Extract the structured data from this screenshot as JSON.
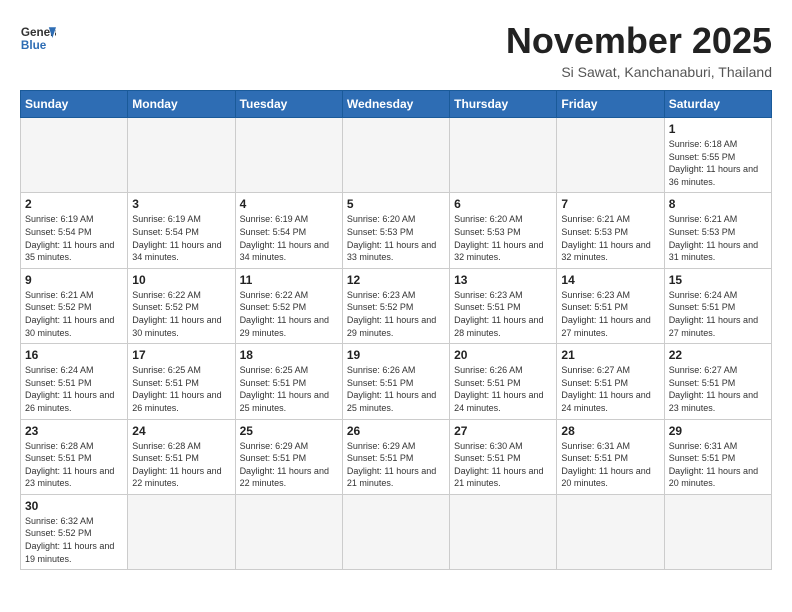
{
  "header": {
    "logo_line1": "General",
    "logo_line2": "Blue",
    "month_title": "November 2025",
    "location": "Si Sawat, Kanchanaburi, Thailand"
  },
  "weekdays": [
    "Sunday",
    "Monday",
    "Tuesday",
    "Wednesday",
    "Thursday",
    "Friday",
    "Saturday"
  ],
  "weeks": [
    [
      {
        "day": "",
        "sunrise": "",
        "sunset": "",
        "daylight": ""
      },
      {
        "day": "",
        "sunrise": "",
        "sunset": "",
        "daylight": ""
      },
      {
        "day": "",
        "sunrise": "",
        "sunset": "",
        "daylight": ""
      },
      {
        "day": "",
        "sunrise": "",
        "sunset": "",
        "daylight": ""
      },
      {
        "day": "",
        "sunrise": "",
        "sunset": "",
        "daylight": ""
      },
      {
        "day": "",
        "sunrise": "",
        "sunset": "",
        "daylight": ""
      },
      {
        "day": "1",
        "sunrise": "Sunrise: 6:18 AM",
        "sunset": "Sunset: 5:55 PM",
        "daylight": "Daylight: 11 hours and 36 minutes."
      }
    ],
    [
      {
        "day": "2",
        "sunrise": "Sunrise: 6:19 AM",
        "sunset": "Sunset: 5:54 PM",
        "daylight": "Daylight: 11 hours and 35 minutes."
      },
      {
        "day": "3",
        "sunrise": "Sunrise: 6:19 AM",
        "sunset": "Sunset: 5:54 PM",
        "daylight": "Daylight: 11 hours and 34 minutes."
      },
      {
        "day": "4",
        "sunrise": "Sunrise: 6:19 AM",
        "sunset": "Sunset: 5:54 PM",
        "daylight": "Daylight: 11 hours and 34 minutes."
      },
      {
        "day": "5",
        "sunrise": "Sunrise: 6:20 AM",
        "sunset": "Sunset: 5:53 PM",
        "daylight": "Daylight: 11 hours and 33 minutes."
      },
      {
        "day": "6",
        "sunrise": "Sunrise: 6:20 AM",
        "sunset": "Sunset: 5:53 PM",
        "daylight": "Daylight: 11 hours and 32 minutes."
      },
      {
        "day": "7",
        "sunrise": "Sunrise: 6:21 AM",
        "sunset": "Sunset: 5:53 PM",
        "daylight": "Daylight: 11 hours and 32 minutes."
      },
      {
        "day": "8",
        "sunrise": "Sunrise: 6:21 AM",
        "sunset": "Sunset: 5:53 PM",
        "daylight": "Daylight: 11 hours and 31 minutes."
      }
    ],
    [
      {
        "day": "9",
        "sunrise": "Sunrise: 6:21 AM",
        "sunset": "Sunset: 5:52 PM",
        "daylight": "Daylight: 11 hours and 30 minutes."
      },
      {
        "day": "10",
        "sunrise": "Sunrise: 6:22 AM",
        "sunset": "Sunset: 5:52 PM",
        "daylight": "Daylight: 11 hours and 30 minutes."
      },
      {
        "day": "11",
        "sunrise": "Sunrise: 6:22 AM",
        "sunset": "Sunset: 5:52 PM",
        "daylight": "Daylight: 11 hours and 29 minutes."
      },
      {
        "day": "12",
        "sunrise": "Sunrise: 6:23 AM",
        "sunset": "Sunset: 5:52 PM",
        "daylight": "Daylight: 11 hours and 29 minutes."
      },
      {
        "day": "13",
        "sunrise": "Sunrise: 6:23 AM",
        "sunset": "Sunset: 5:51 PM",
        "daylight": "Daylight: 11 hours and 28 minutes."
      },
      {
        "day": "14",
        "sunrise": "Sunrise: 6:23 AM",
        "sunset": "Sunset: 5:51 PM",
        "daylight": "Daylight: 11 hours and 27 minutes."
      },
      {
        "day": "15",
        "sunrise": "Sunrise: 6:24 AM",
        "sunset": "Sunset: 5:51 PM",
        "daylight": "Daylight: 11 hours and 27 minutes."
      }
    ],
    [
      {
        "day": "16",
        "sunrise": "Sunrise: 6:24 AM",
        "sunset": "Sunset: 5:51 PM",
        "daylight": "Daylight: 11 hours and 26 minutes."
      },
      {
        "day": "17",
        "sunrise": "Sunrise: 6:25 AM",
        "sunset": "Sunset: 5:51 PM",
        "daylight": "Daylight: 11 hours and 26 minutes."
      },
      {
        "day": "18",
        "sunrise": "Sunrise: 6:25 AM",
        "sunset": "Sunset: 5:51 PM",
        "daylight": "Daylight: 11 hours and 25 minutes."
      },
      {
        "day": "19",
        "sunrise": "Sunrise: 6:26 AM",
        "sunset": "Sunset: 5:51 PM",
        "daylight": "Daylight: 11 hours and 25 minutes."
      },
      {
        "day": "20",
        "sunrise": "Sunrise: 6:26 AM",
        "sunset": "Sunset: 5:51 PM",
        "daylight": "Daylight: 11 hours and 24 minutes."
      },
      {
        "day": "21",
        "sunrise": "Sunrise: 6:27 AM",
        "sunset": "Sunset: 5:51 PM",
        "daylight": "Daylight: 11 hours and 24 minutes."
      },
      {
        "day": "22",
        "sunrise": "Sunrise: 6:27 AM",
        "sunset": "Sunset: 5:51 PM",
        "daylight": "Daylight: 11 hours and 23 minutes."
      }
    ],
    [
      {
        "day": "23",
        "sunrise": "Sunrise: 6:28 AM",
        "sunset": "Sunset: 5:51 PM",
        "daylight": "Daylight: 11 hours and 23 minutes."
      },
      {
        "day": "24",
        "sunrise": "Sunrise: 6:28 AM",
        "sunset": "Sunset: 5:51 PM",
        "daylight": "Daylight: 11 hours and 22 minutes."
      },
      {
        "day": "25",
        "sunrise": "Sunrise: 6:29 AM",
        "sunset": "Sunset: 5:51 PM",
        "daylight": "Daylight: 11 hours and 22 minutes."
      },
      {
        "day": "26",
        "sunrise": "Sunrise: 6:29 AM",
        "sunset": "Sunset: 5:51 PM",
        "daylight": "Daylight: 11 hours and 21 minutes."
      },
      {
        "day": "27",
        "sunrise": "Sunrise: 6:30 AM",
        "sunset": "Sunset: 5:51 PM",
        "daylight": "Daylight: 11 hours and 21 minutes."
      },
      {
        "day": "28",
        "sunrise": "Sunrise: 6:31 AM",
        "sunset": "Sunset: 5:51 PM",
        "daylight": "Daylight: 11 hours and 20 minutes."
      },
      {
        "day": "29",
        "sunrise": "Sunrise: 6:31 AM",
        "sunset": "Sunset: 5:51 PM",
        "daylight": "Daylight: 11 hours and 20 minutes."
      }
    ],
    [
      {
        "day": "30",
        "sunrise": "Sunrise: 6:32 AM",
        "sunset": "Sunset: 5:52 PM",
        "daylight": "Daylight: 11 hours and 19 minutes."
      },
      {
        "day": "",
        "sunrise": "",
        "sunset": "",
        "daylight": ""
      },
      {
        "day": "",
        "sunrise": "",
        "sunset": "",
        "daylight": ""
      },
      {
        "day": "",
        "sunrise": "",
        "sunset": "",
        "daylight": ""
      },
      {
        "day": "",
        "sunrise": "",
        "sunset": "",
        "daylight": ""
      },
      {
        "day": "",
        "sunrise": "",
        "sunset": "",
        "daylight": ""
      },
      {
        "day": "",
        "sunrise": "",
        "sunset": "",
        "daylight": ""
      }
    ]
  ]
}
